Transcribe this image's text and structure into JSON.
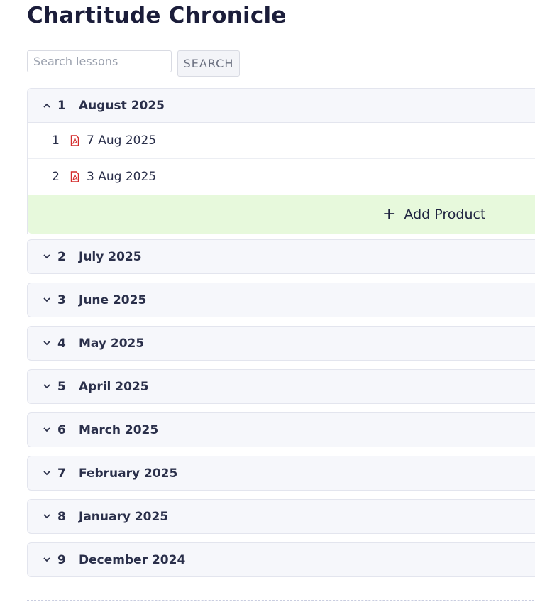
{
  "page": {
    "title": "Chartitude Chronicle"
  },
  "search": {
    "placeholder": "Search lessons",
    "button_label": "SEARCH"
  },
  "add_product_label": "Add Product",
  "sections": [
    {
      "number": "1",
      "title": "August 2025",
      "expanded": true,
      "lessons": [
        {
          "number": "1",
          "title": "7 Aug 2025",
          "icon": "pdf-icon"
        },
        {
          "number": "2",
          "title": "3 Aug 2025",
          "icon": "pdf-icon"
        }
      ]
    },
    {
      "number": "2",
      "title": "July 2025",
      "expanded": false
    },
    {
      "number": "3",
      "title": "June 2025",
      "expanded": false
    },
    {
      "number": "4",
      "title": "May 2025",
      "expanded": false
    },
    {
      "number": "5",
      "title": "April 2025",
      "expanded": false
    },
    {
      "number": "6",
      "title": "March 2025",
      "expanded": false
    },
    {
      "number": "7",
      "title": "February 2025",
      "expanded": false
    },
    {
      "number": "8",
      "title": "January 2025",
      "expanded": false
    },
    {
      "number": "9",
      "title": "December 2024",
      "expanded": false
    }
  ],
  "colors": {
    "accent_add_row": "#e7f9dc",
    "pdf_red": "#d42b2b",
    "header_bg": "#f6f7fb"
  }
}
